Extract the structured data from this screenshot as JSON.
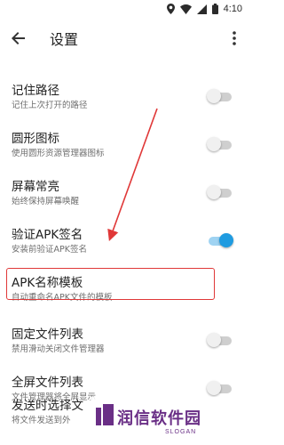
{
  "status_bar": {
    "time": "4:10"
  },
  "app_bar": {
    "title": "设置"
  },
  "settings": [
    {
      "title": "记住路径",
      "subtitle": "记住上次打开的路径",
      "on": false
    },
    {
      "title": "圆形图标",
      "subtitle": "使用圆形资源管理器图标",
      "on": false
    },
    {
      "title": "屏幕常亮",
      "subtitle": "始终保持屏幕唤醒",
      "on": false
    },
    {
      "title": "验证APK签名",
      "subtitle": "安装前验证APK签名",
      "on": true
    },
    {
      "title": "APK名称模板",
      "subtitle": "自动重命名APK文件的模板"
    },
    {
      "title": "固定文件列表",
      "subtitle": "禁用滑动关闭文件管理器",
      "on": false
    },
    {
      "title": "全屏文件列表",
      "subtitle": "文件管理器将全屏显示",
      "on": false
    },
    {
      "title": "发送时选择文",
      "subtitle": "将文件发送到外"
    }
  ],
  "watermark": {
    "text": "润信软件园",
    "slogan": "SLOGAN"
  },
  "colors": {
    "accent": "#1f9be0",
    "highlight": "#e03838",
    "watermark": "#6a2f86"
  }
}
